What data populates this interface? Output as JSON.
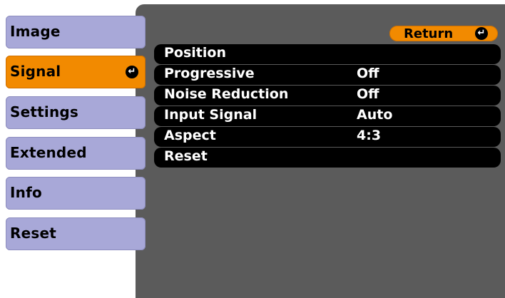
{
  "menu": {
    "items": [
      {
        "label": "Image"
      },
      {
        "label": "Signal"
      },
      {
        "label": "Settings"
      },
      {
        "label": "Extended"
      },
      {
        "label": "Info"
      },
      {
        "label": "Reset"
      }
    ],
    "active_index": 1,
    "enter_icon": "enter-icon"
  },
  "header": {
    "return_label": "Return"
  },
  "options": [
    {
      "label": "Position",
      "value": ""
    },
    {
      "label": "Progressive",
      "value": "Off"
    },
    {
      "label": "Noise Reduction",
      "value": "Off"
    },
    {
      "label": "Input Signal",
      "value": "Auto"
    },
    {
      "label": "Aspect",
      "value": "4:3"
    },
    {
      "label": "Reset",
      "value": ""
    }
  ],
  "colors": {
    "panel": "#5b5b5b",
    "menu_item": "#a8a8d8",
    "active": "#f28a00",
    "row": "#000000"
  }
}
